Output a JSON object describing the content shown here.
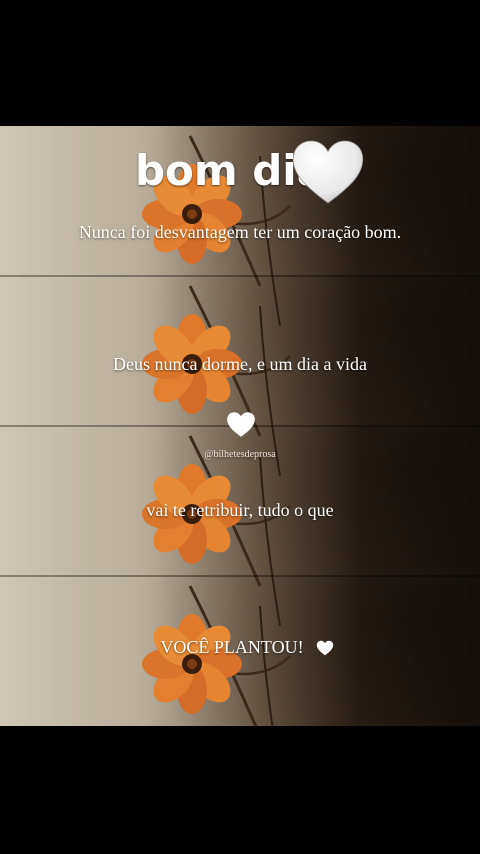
{
  "texts": {
    "title": "bom dia",
    "line1": "Nunca foi desvantagem ter um coração bom.",
    "line2": "Deus nunca dorme, e um dia a vida",
    "handle": "@bilhetesdeprosa",
    "line3": "vai te retribuir, tudo o que",
    "line4": "VOCÊ PLANTOU!"
  },
  "icons": [
    "white-heart-icon",
    "flower-icon"
  ],
  "colors": {
    "flower": "#e07a2a",
    "flower_center": "#3a1c0a",
    "text": "#ffffff",
    "letterbox": "#000000"
  }
}
